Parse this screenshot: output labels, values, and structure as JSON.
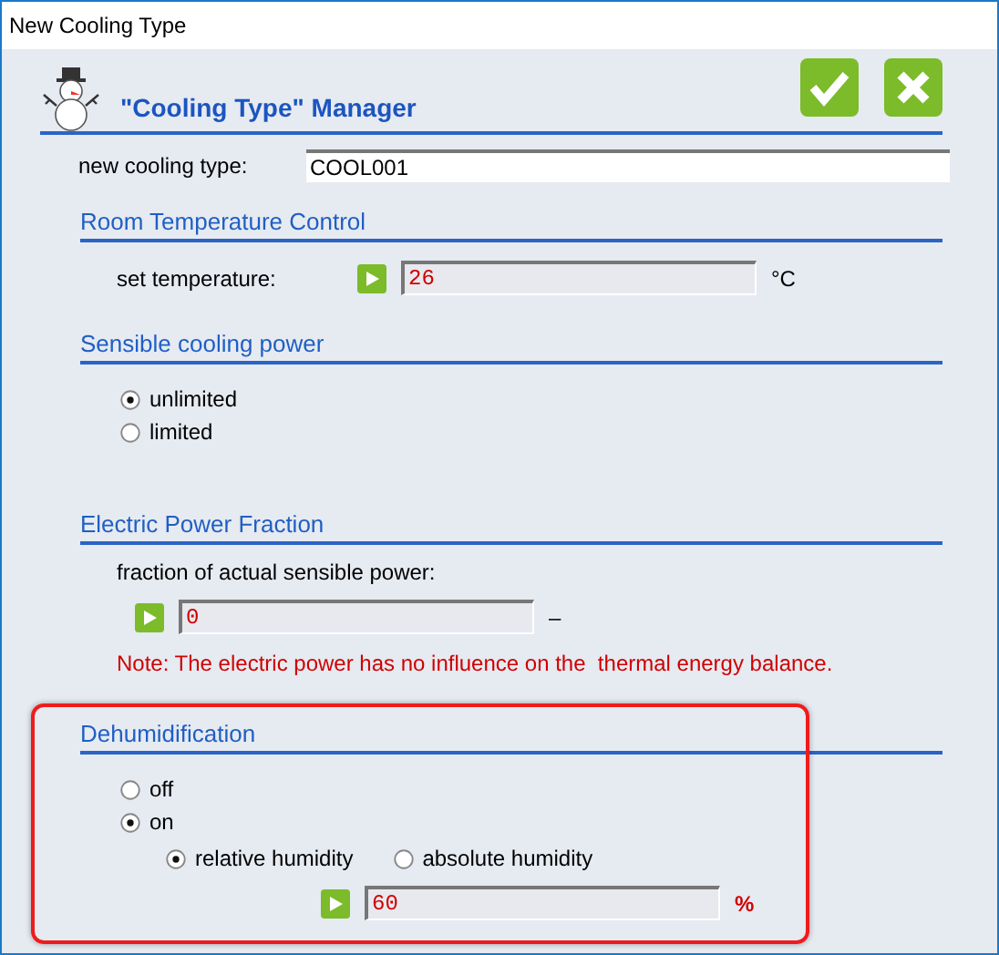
{
  "window": {
    "title": "New Cooling Type"
  },
  "header": {
    "title": "\"Cooling Type\" Manager"
  },
  "actions": [
    {
      "kind": "confirm"
    },
    {
      "kind": "cancel"
    }
  ],
  "name_field": {
    "label": "new cooling type:",
    "value": "COOL001"
  },
  "sections": [
    {
      "kind": "value",
      "title": "Room Temperature Control",
      "label": "set temperature:",
      "value": "26",
      "unit": "°C"
    },
    {
      "kind": "radios",
      "title": "Sensible cooling power",
      "options": [
        {
          "label": "unlimited",
          "selected": true
        },
        {
          "label": "limited",
          "selected": false
        }
      ]
    },
    {
      "kind": "stacked",
      "title": "Electric Power Fraction",
      "label": "fraction of actual sensible power:",
      "value": "0",
      "unit": "–",
      "note": "Note: The electric power has no influence on the  thermal energy balance."
    },
    {
      "kind": "dehumid",
      "title": "Dehumidification",
      "highlighted": true,
      "options": [
        {
          "label": "off",
          "selected": false
        },
        {
          "label": "on",
          "selected": true
        }
      ],
      "sub_options": [
        {
          "label": "relative humidity",
          "selected": true
        },
        {
          "label": "absolute humidity",
          "selected": false
        }
      ],
      "value": "60",
      "unit": "%"
    }
  ]
}
